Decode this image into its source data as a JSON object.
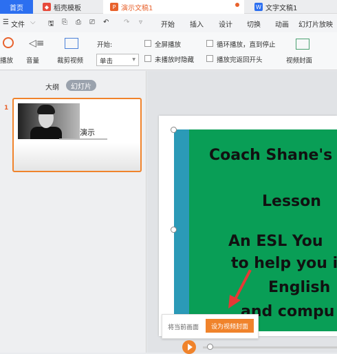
{
  "tabs": {
    "home": "首页",
    "template": "稻壳模板",
    "presentation": "演示文稿1",
    "text_doc": "文字文稿1"
  },
  "menu": {
    "file": "文件",
    "start": "开始",
    "insert": "插入",
    "design": "设计",
    "switch": "切换",
    "animation": "动画",
    "slideshow": "幻灯片放映"
  },
  "ribbon": {
    "play": "播放",
    "volume": "音量",
    "crop_video": "裁剪视频",
    "start_label": "开始:",
    "start_value": "单击",
    "fullscreen": "全屏播放",
    "hide_when_not_playing": "未播放时隐藏",
    "loop": "循环播放，直到停止",
    "rewind": "播放完返回开头",
    "video_cover": "视频封面"
  },
  "panel": {
    "outline": "大纲",
    "slides": "幻灯片",
    "slide_number": "1",
    "thumb_title": "演示"
  },
  "slide": {
    "line1": "Coach Shane's",
    "line2": "Lesson",
    "line3": "An ESL You",
    "line4": "to help you i",
    "line5": "English",
    "line6": "and compu"
  },
  "tooltip": {
    "label": "将当前画面",
    "button": "设为视频封面"
  },
  "colors": {
    "accent": "#f0832b",
    "brand_blue": "#2c6ff0",
    "slide_green": "#099e56",
    "slide_stripe": "#2b9ab7"
  }
}
